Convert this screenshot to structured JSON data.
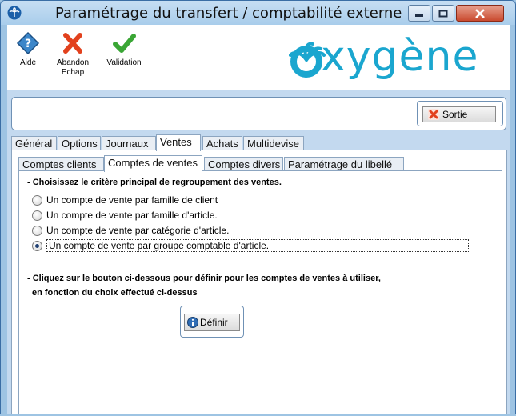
{
  "window": {
    "title": "Paramétrage du transfert / comptabilité externe",
    "controls": [
      "minimize",
      "maximize",
      "close"
    ]
  },
  "toolbar": {
    "aide_label": "Aide",
    "abandon_label_line1": "Abandon",
    "abandon_label_line2": "Echap",
    "validation_label": "Validation"
  },
  "logo": {
    "text": "xygène"
  },
  "header": {
    "sortie_label": "Sortie"
  },
  "main_tabs": [
    "Général",
    "Options",
    "Journaux",
    "Ventes",
    "Achats",
    "Multidevise"
  ],
  "main_tabs_active": "Ventes",
  "sub_tabs": [
    "Comptes clients",
    "Comptes de ventes",
    "Comptes divers",
    "Paramétrage du libellé"
  ],
  "sub_tabs_active": "Comptes de ventes",
  "content": {
    "question": "- Choisissez le critère principal de regroupement des ventes.",
    "options": [
      "Un compte de vente par famille de client",
      "Un compte de vente par famille d'article.",
      "Un compte de vente par catégorie d'article.",
      "Un compte de vente par groupe comptable d'article."
    ],
    "selected_index": 3,
    "instruction_line1": "- Cliquez sur le bouton ci-dessous pour définir pour les comptes de ventes à utiliser,",
    "instruction_line2": "en fonction du choix effectué ci-dessus",
    "define_label": "Définir"
  },
  "colors": {
    "accent": "#1aa6cf",
    "close_red": "#c94a2f",
    "validation_green": "#3aa635",
    "abandon_red": "#e2411d"
  }
}
